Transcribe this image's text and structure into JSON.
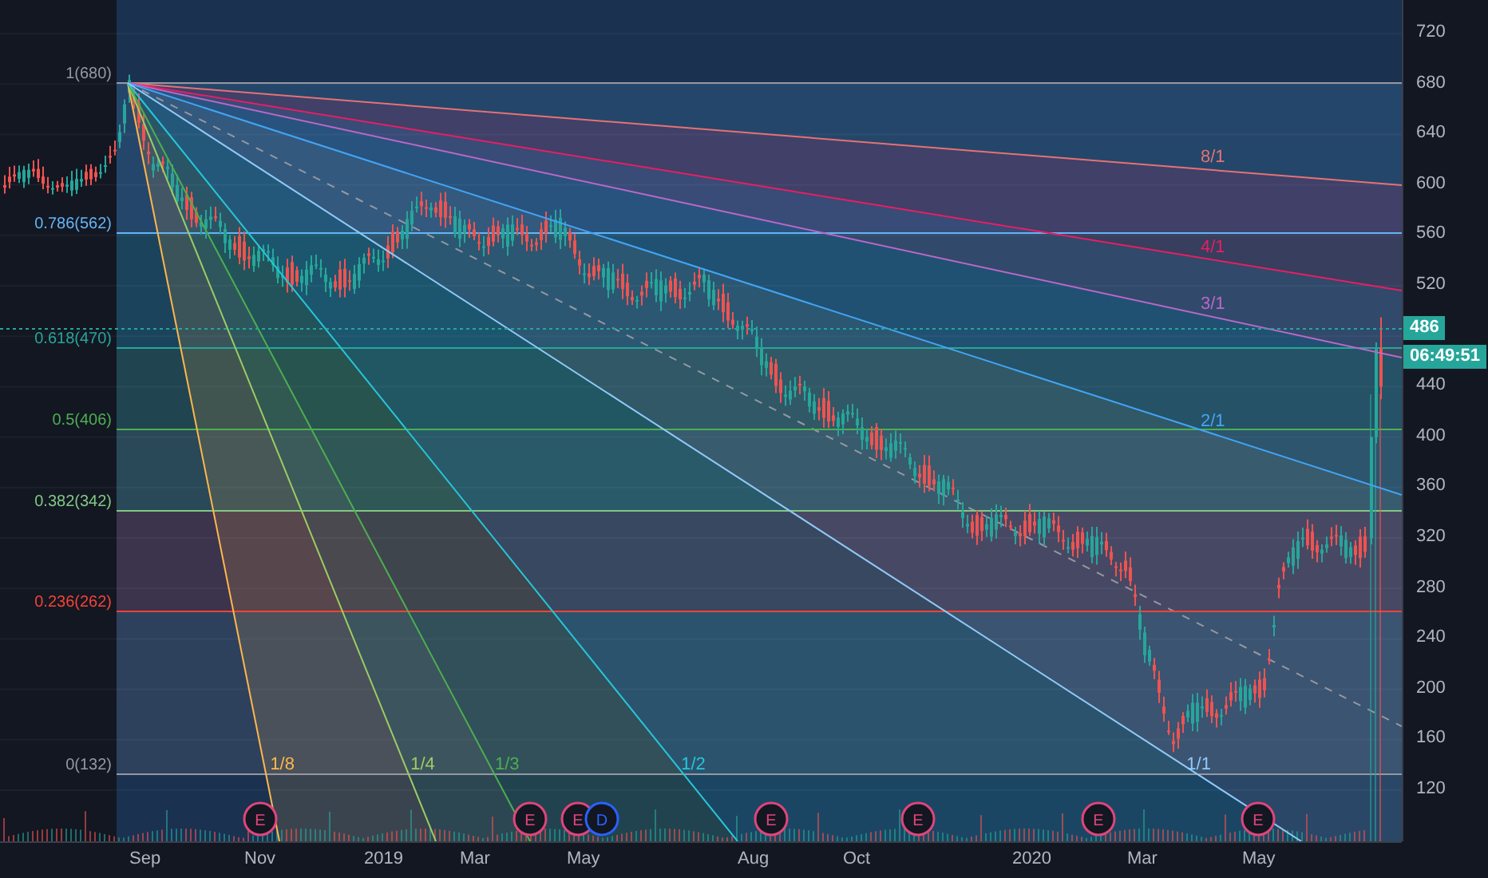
{
  "chart": {
    "price_axis": {
      "labels": [
        "720",
        "680",
        "640",
        "600",
        "560",
        "520",
        "440",
        "400",
        "360",
        "320",
        "280",
        "240",
        "200",
        "160",
        "120"
      ]
    },
    "time_axis": {
      "labels": [
        "Sep",
        "Nov",
        "2019",
        "Mar",
        "May",
        "Aug",
        "Oct",
        "2020",
        "Mar",
        "May"
      ]
    },
    "fib_levels": [
      {
        "label": "1(680)",
        "color": "#9598a1"
      },
      {
        "label": "0.786(562)",
        "color": "#64b5f6"
      },
      {
        "label": "0.618(470)",
        "color": "#26a69a"
      },
      {
        "label": "0.5(406)",
        "color": "#4caf50"
      },
      {
        "label": "0.382(342)",
        "color": "#81c784"
      },
      {
        "label": "0.236(262)",
        "color": "#f44336"
      },
      {
        "label": "0(132)",
        "color": "#9598a1"
      }
    ],
    "fan_lines": [
      {
        "label": "8/1",
        "color": "#e57373"
      },
      {
        "label": "4/1",
        "color": "#e91e63"
      },
      {
        "label": "3/1",
        "color": "#ba68c8"
      },
      {
        "label": "2/1",
        "color": "#42a5f5"
      },
      {
        "label": "1/8",
        "color": "#ffb74d"
      },
      {
        "label": "1/4",
        "color": "#9ccc65"
      },
      {
        "label": "1/3",
        "color": "#4caf50"
      },
      {
        "label": "1/2",
        "color": "#26c6da"
      },
      {
        "label": "1/1",
        "color": "#90caf9"
      }
    ],
    "events": [
      {
        "kind": "earnings",
        "label": "E"
      },
      {
        "kind": "earnings",
        "label": "E"
      },
      {
        "kind": "earnings",
        "label": "E"
      },
      {
        "kind": "dividend",
        "label": "D"
      },
      {
        "kind": "earnings",
        "label": "E"
      },
      {
        "kind": "earnings",
        "label": "E"
      },
      {
        "kind": "earnings",
        "label": "E"
      },
      {
        "kind": "earnings",
        "label": "E"
      }
    ],
    "last_price": {
      "value": "486",
      "countdown": "06:49:51"
    }
  }
}
